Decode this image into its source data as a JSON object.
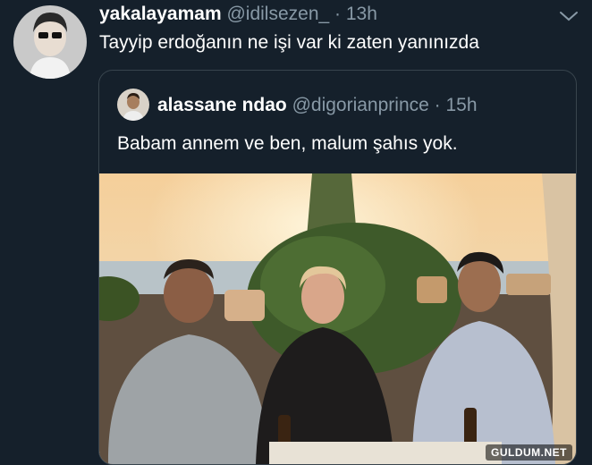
{
  "tweet": {
    "display_name": "yakalayamam",
    "handle": "@idilsezen_",
    "separator": "·",
    "time": "13h",
    "text": "Tayyip erdoğanın ne işi var ki zaten yanınızda"
  },
  "quoted_tweet": {
    "display_name": "alassane ndao",
    "handle": "@digorianprince",
    "separator": "·",
    "time": "15h",
    "text": "Babam annem ve ben, malum şahıs yok."
  },
  "watermark": "GULDUM.NET",
  "icons": {
    "menu": "chevron-down-icon"
  },
  "colors": {
    "background": "#15202b",
    "secondary_text": "#8899a6",
    "border": "#38444d"
  }
}
